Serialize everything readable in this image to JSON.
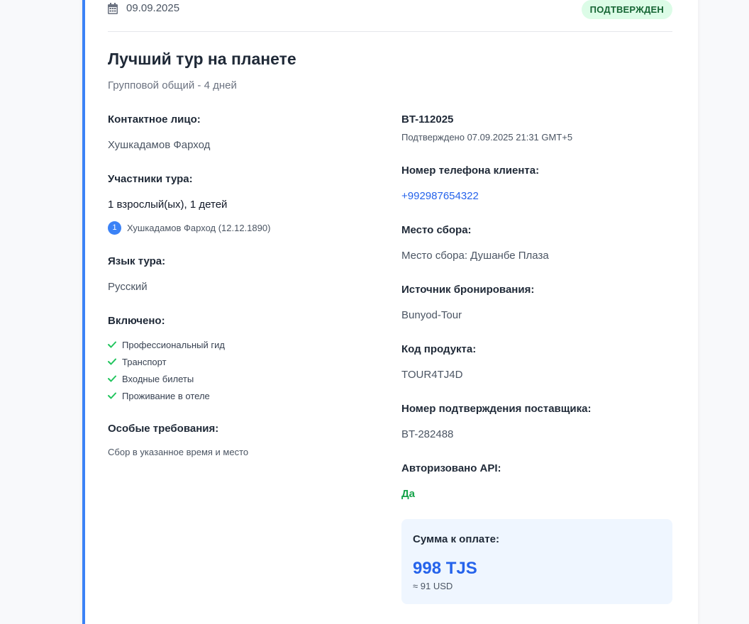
{
  "header": {
    "date": "09.09.2025",
    "status_badge": "ПОДТВЕРЖДЕН"
  },
  "tour": {
    "title": "Лучший тур на планете",
    "subtitle": "Групповой общий - 4 дней"
  },
  "left": {
    "contact_label": "Контактное лицо:",
    "contact_value": "Хушкадамов Фарход",
    "participants_label": "Участники тура:",
    "participants_value": "1 взрослый(ых), 1 детей",
    "participants": [
      {
        "num": "1",
        "name": "Хушкадамов Фарход (12.12.1890)"
      }
    ],
    "language_label": "Язык тура:",
    "language_value": "Русский",
    "included_label": "Включено:",
    "included_items": [
      "Профессиональный гид",
      "Транспорт",
      "Входные билеты",
      "Проживание в отеле"
    ],
    "requirements_label": "Особые требования:",
    "requirements_value": "Сбор в указанное время и место"
  },
  "right": {
    "booking_code": "BT-112025",
    "confirmed_text": "Подтверждено 07.09.2025 21:31 GMT+5",
    "phone_label": "Номер телефона клиента:",
    "phone_value": "+992987654322",
    "meeting_label": "Место сбора:",
    "meeting_value": "Место сбора: Душанбе Плаза",
    "source_label": "Источник бронирования:",
    "source_value": "Bunyod-Tour",
    "product_label": "Код продукта:",
    "product_value": "TOUR4TJ4D",
    "supplier_label": "Номер подтверждения поставщика:",
    "supplier_value": "BT-282488",
    "api_label": "Авторизовано API:",
    "api_value": "Да"
  },
  "payment": {
    "label": "Сумма к оплате:",
    "amount": "998 TJS",
    "usd": "≈ 91 USD"
  },
  "colors": {
    "accent": "#3b82f6",
    "link": "#2563eb",
    "success": "#16a34a",
    "badge_bg": "#dcfce7"
  },
  "icons": [
    "calendar-icon",
    "check-icon"
  ]
}
